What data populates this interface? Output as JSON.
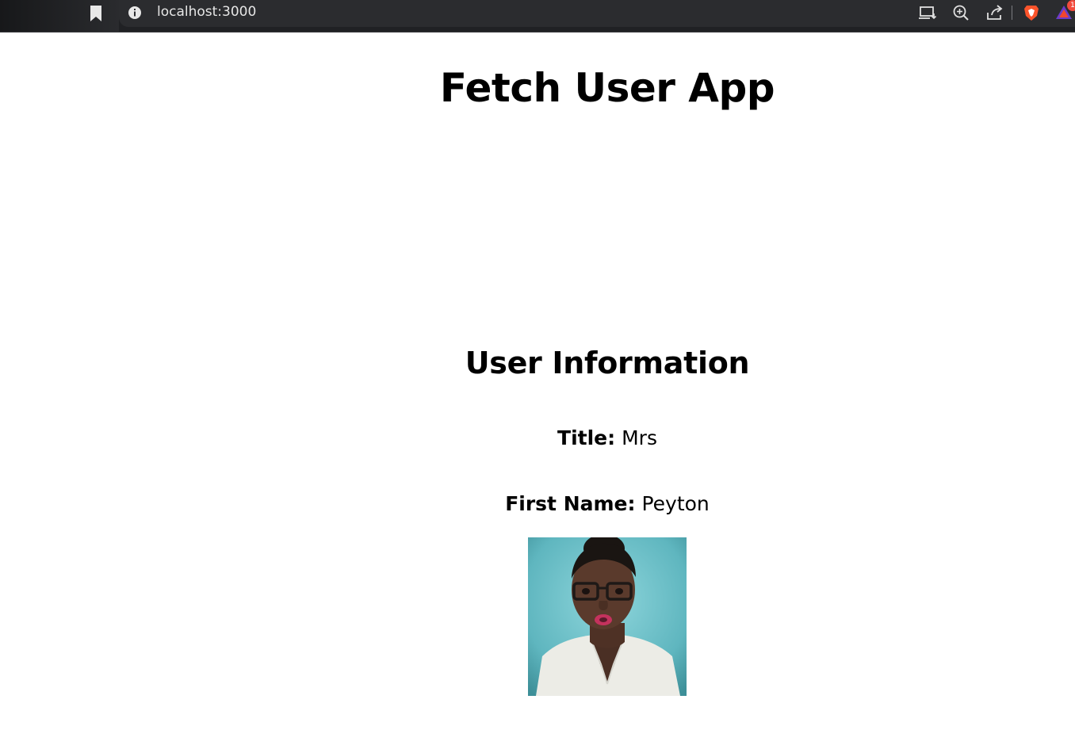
{
  "browser": {
    "url": "localhost:3000",
    "notification_count": "1",
    "icons": [
      "bookmark-icon",
      "site-info-icon",
      "install-app-icon",
      "zoom-icon",
      "share-icon",
      "brave-shield-icon",
      "brave-rewards-icon"
    ],
    "colors": {
      "chrome_bg": "#202124",
      "omnibox_bg": "#2b2c2f",
      "brave_orange": "#fb542b"
    }
  },
  "page": {
    "title": "Fetch User App",
    "section_title": "User Information",
    "fields": [
      {
        "label": "Title:",
        "value": "Mrs"
      },
      {
        "label": "First Name:",
        "value": "Peyton"
      }
    ],
    "avatar_icon": "user-photo"
  }
}
